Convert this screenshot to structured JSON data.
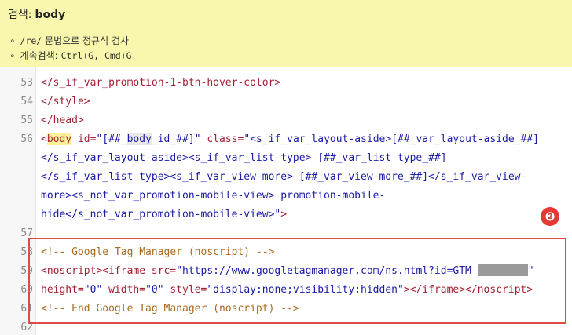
{
  "search": {
    "label": "검색:",
    "query": "body",
    "hint_regex_code": "/re/",
    "hint_regex_text": "문법으로 정규식 검사",
    "hint_next_label": "계속검색:",
    "hint_next_keys": "Ctrl+G, Cmd+G"
  },
  "editor": {
    "line_numbers": [
      "53",
      "54",
      "55",
      "56",
      "",
      "",
      "",
      "",
      "57",
      "58",
      "59",
      "60",
      "61",
      "62"
    ],
    "line53": "</s_if_var_promotion-1-btn-hover-color>",
    "line54": "</style>",
    "line55": "</head>",
    "line56a_tag_open": "<",
    "line56a_body_word": "body",
    "line56a_attr1": " id=",
    "line56a_val1_pre": "\"[##_",
    "line56a_val1_hit": "body",
    "line56a_val1_post": "_id_##]\"",
    "line56a_attr2": " class=",
    "line56a_val2": "\"<s_if_var_layout-aside>[##_var_layout-aside_##]",
    "line56b": "</s_if_var_layout-aside><s_if_var_list-type> [##_var_list-type_##]",
    "line56c": "</s_if_var_list-type><s_if_var_view-more> [##_var_view-more_##]</s_if_var_view-",
    "line56d": "more><s_not_var_promotion-mobile-view> promotion-mobile-",
    "line56e_val": "hide</s_not_var_promotion-mobile-view>\"",
    "line56e_close": ">",
    "line58": "<!-- Google Tag Manager (noscript) -->",
    "line59_tag1": "<noscript><iframe",
    "line59_attr": " src=",
    "line59_val": "\"https://www.googletagmanager.com/ns.html?id=GTM-",
    "line59_val_end": "\"",
    "line60_attr1": "height=",
    "line60_val1": "\"0\"",
    "line60_attr2": " width=",
    "line60_val2": "\"0\"",
    "line60_attr3": " style=",
    "line60_val3": "\"display:none;visibility:hidden\"",
    "line60_tags": "></iframe></noscript>",
    "line61": "<!-- End Google Tag Manager (noscript) -->"
  },
  "annotation": {
    "badge": "❷",
    "color": "#e53935"
  }
}
